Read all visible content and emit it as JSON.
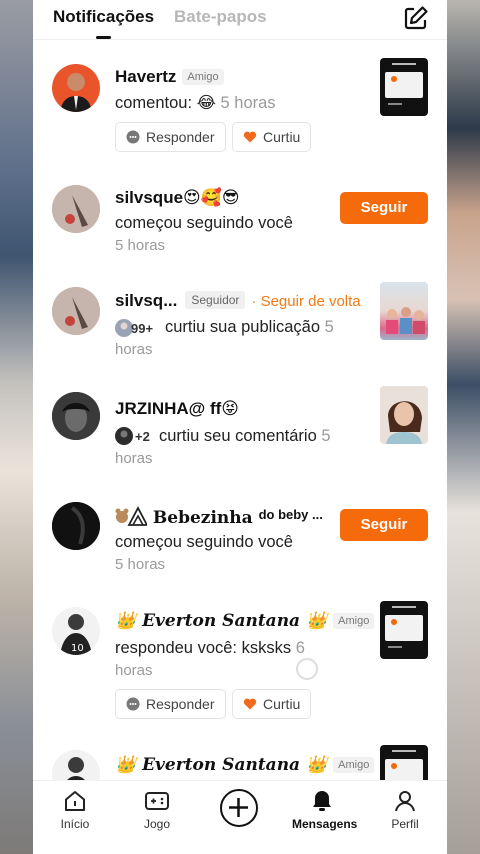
{
  "tabs": {
    "active": "Notificações",
    "inactive": "Bate-papos"
  },
  "notifications": [
    {
      "name": "Havertz",
      "badge": "Amigo",
      "action": "comentou: 😂",
      "time": "5 horas",
      "reply": "Responder",
      "like": "Curtiu"
    },
    {
      "name": "silvsque😍🥰😎",
      "action": "começou seguindo você",
      "time": "5 horas",
      "button": "Seguir"
    },
    {
      "name": "silvsq...",
      "badge": "Seguidor",
      "followback": "· Seguir de volta",
      "count": "99+",
      "action": "curtiu sua publicação",
      "time_inline": "5",
      "time_next": "horas"
    },
    {
      "name": "JRZINHA@ ff😝",
      "count": "+2",
      "action": "curtiu seu comentário",
      "time_inline": "5",
      "time_next": "horas"
    },
    {
      "name": "Bebezinha",
      "name_suffix": "do beby ...",
      "action": "começou seguindo você",
      "time": "5 horas",
      "button": "Seguir"
    },
    {
      "name_prefix": "👑",
      "name": "Everton Santana",
      "name_suffix": "👑",
      "badge": "Amigo",
      "action": "respondeu você: ksksks",
      "time_inline": "6",
      "time_next": "horas",
      "reply": "Responder",
      "like": "Curtiu"
    },
    {
      "name_prefix": "👑",
      "name": "Everton Santana",
      "name_suffix": "👑",
      "badge": "Amigo"
    }
  ],
  "nav": {
    "home": "Início",
    "game": "Jogo",
    "messages": "Mensagens",
    "profile": "Perfil"
  },
  "colors": {
    "accent": "#f56a0a",
    "followback": "#f27a14"
  }
}
